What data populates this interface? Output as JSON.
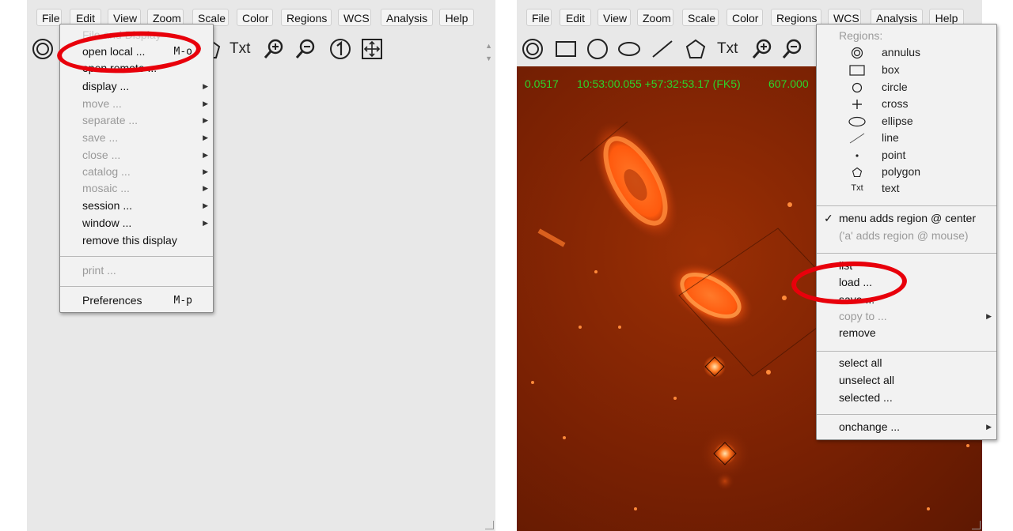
{
  "menubar_items": [
    "File",
    "Edit",
    "View",
    "Zoom",
    "Scale",
    "Color",
    "Regions",
    "WCS",
    "Analysis",
    "Help"
  ],
  "toolbar": {
    "text_tool_label": "Txt"
  },
  "left": {
    "file_menu": {
      "faded_header": "File and Display",
      "open_local": {
        "label": "open local ...",
        "accel": "M-o"
      },
      "open_remote": {
        "label": "open remote ..."
      },
      "items": [
        {
          "label": "display ...",
          "disabled": false
        },
        {
          "label": "move ...",
          "disabled": true
        },
        {
          "label": "separate ...",
          "disabled": true
        },
        {
          "label": "save ...",
          "disabled": true
        },
        {
          "label": "close ...",
          "disabled": true
        },
        {
          "label": "catalog ...",
          "disabled": true
        },
        {
          "label": "mosaic ...",
          "disabled": true
        },
        {
          "label": "session ...",
          "disabled": false
        },
        {
          "label": "window ...",
          "disabled": false
        }
      ],
      "remove_display": "remove this display",
      "print": "print ...",
      "preferences": {
        "label": "Preferences",
        "accel": "M-p"
      }
    }
  },
  "right": {
    "status": {
      "value": "0.0517",
      "coords": "10:53:00.055 +57:32:53.17 (FK5)",
      "pixel": "607.000"
    },
    "regions_menu": {
      "header": "Regions:",
      "shapes": [
        {
          "label": "annulus",
          "icon": "annulus-icon"
        },
        {
          "label": "box",
          "icon": "box-icon"
        },
        {
          "label": "circle",
          "icon": "circle-icon"
        },
        {
          "label": "cross",
          "icon": "cross-icon"
        },
        {
          "label": "ellipse",
          "icon": "ellipse-icon"
        },
        {
          "label": "line",
          "icon": "line-icon"
        },
        {
          "label": "point",
          "icon": "point-icon"
        },
        {
          "label": "polygon",
          "icon": "polygon-icon"
        },
        {
          "label": "text",
          "icon": "text-icon",
          "glyph": "Txt"
        }
      ],
      "check_mark": "✓",
      "menu_adds": "menu adds region @ center",
      "mouse_adds": "('a' adds region @ mouse)",
      "list": "list",
      "load": "load ...",
      "save": "save ...",
      "copy_to": "copy to ...",
      "remove": "remove",
      "select_all": "select all",
      "unselect_all": "unselect all",
      "selected": "selected ...",
      "onchange": "onchange ..."
    }
  },
  "colors": {
    "highlight_ring": "#e8000b",
    "status_text": "#2bd52b",
    "image_base": "#7a2103"
  }
}
